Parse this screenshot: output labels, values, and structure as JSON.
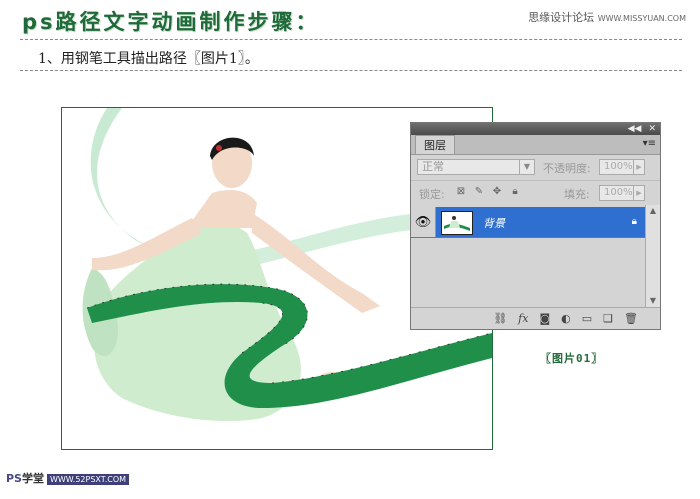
{
  "header": {
    "title": "ps路径文字动画制作步骤：",
    "site_name": "思缘设计论坛",
    "site_url": "WWW.MISSYUAN.COM"
  },
  "step": {
    "text": "1、用钢笔工具描出路径〖图片1〗。"
  },
  "figure": {
    "caption": "〖图片01〗"
  },
  "layers_panel": {
    "tab_label": "图层",
    "blend_mode": "正常",
    "opacity_label": "不透明度:",
    "opacity_value": "100%",
    "lock_label": "锁定:",
    "fill_label": "填充:",
    "fill_value": "100%",
    "layers": [
      {
        "name": "背景",
        "visible": true,
        "locked": true,
        "selected": true
      }
    ],
    "selected_color": "#2f6fcf"
  },
  "footer": {
    "logo_ps": "PS",
    "logo_text": "学堂",
    "logo_url": "WWW.52PSXT.COM"
  },
  "colors": {
    "accent_green": "#1e6a3a",
    "panel_bg": "#d4d4d4"
  }
}
